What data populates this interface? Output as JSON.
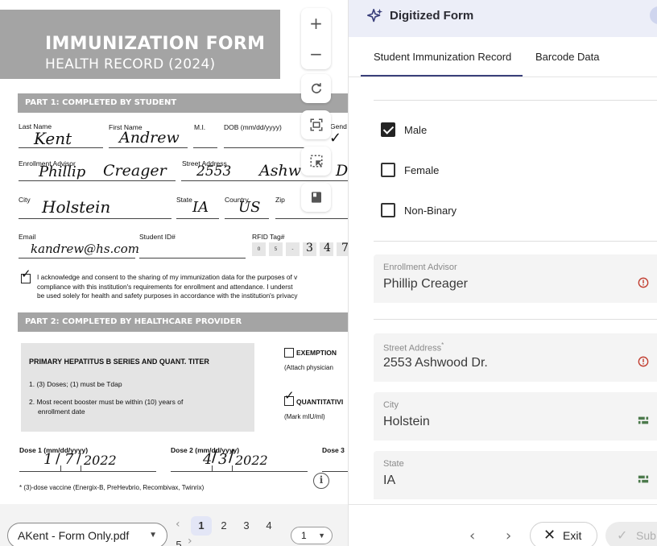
{
  "document": {
    "banner_title": "IMMUNIZATION FORM",
    "banner_subtitle": "HEALTH RECORD (2024)",
    "part1_title": "PART 1: COMPLETED BY STUDENT",
    "part2_title": "PART 2: COMPLETED BY HEALTHCARE PROVIDER",
    "labels": {
      "last_name": "Last Name",
      "first_name": "First Name",
      "mi": "M.I.",
      "dob": "DOB (mm/dd/yyyy)",
      "gender": "Gend",
      "advisor": "Enrollment Advisor",
      "street": "Street Address",
      "city": "City",
      "state": "State",
      "country": "Country",
      "zip": "Zip",
      "email": "Email",
      "student_id": "Student ID#",
      "rfid": "RFID Tag#"
    },
    "handwritten": {
      "last_name": "Kent",
      "first_name": "Andrew",
      "advisor_first": "Phillip",
      "advisor_last": "Creager",
      "street_number": "2553",
      "street_name": "Ashw",
      "street_extra": "D",
      "city": "Holstein",
      "state": "IA",
      "country": "US",
      "email": "kandrew@hs.com",
      "rfid_3": "3",
      "rfid_4": "4",
      "rfid_5": "7",
      "dose1_m": "1",
      "dose1_d": "7",
      "dose1_y": "2022",
      "dose2_m": "4",
      "dose2_d": "3",
      "dose2_y": "2022"
    },
    "rfid_cells": [
      "0",
      "5",
      "-"
    ],
    "ack_lines": [
      "I acknowledge and consent to the sharing of my immunization data for the purposes of v",
      "compliance with this institution's requirements for enrollment and attendance. I underst",
      "be used solely for health and safety purposes in accordance with the institution's privacy"
    ],
    "hepb": {
      "title": "PRIMARY HEPATITUS B SERIES AND QUANT. TITER",
      "line1": "1. (3) Doses; (1) must be Tdap",
      "line2a": "2. Most recent booster must be within (10) years of",
      "line2b": "enrollment date"
    },
    "exemption_label": "EXEMPTION",
    "exemption_note": "(Attach physician",
    "quantitative_label": "QUANTITATIVI",
    "quantitative_note": "(Mark mIU/ml)",
    "dose1_label": "Dose 1 (mm/dd/yyyy)",
    "dose2_label": "Dose 2 (mm/dd/yyyy)",
    "dose3_label": "Dose 3",
    "vaccine_note": "* (3)-dose vaccine (Energix-B, PreHevbrio, Recombivax, Twinrix)"
  },
  "toolbar": {
    "zoom_in": "+",
    "zoom_out": "−"
  },
  "pager": {
    "file_name": "AKent - Form Only.pdf",
    "pages": [
      "1",
      "2",
      "3",
      "4",
      "5"
    ],
    "active_page": "1",
    "page_select": "1"
  },
  "form": {
    "title": "Digitized Form",
    "tabs": [
      "Student Immunization Record",
      "Barcode Data"
    ],
    "gender_options": [
      {
        "label": "Male",
        "checked": true
      },
      {
        "label": "Female",
        "checked": false
      },
      {
        "label": "Non-Binary",
        "checked": false
      }
    ],
    "fields": {
      "advisor": {
        "label": "Enrollment Advisor",
        "value": "Phillip Creager",
        "status": "error"
      },
      "street": {
        "label": "Street Address",
        "required_mark": "*",
        "value": "2553 Ashwood Dr.",
        "status": "error"
      },
      "city": {
        "label": "City",
        "value": "Holstein",
        "status": "barcode"
      },
      "state": {
        "label": "State",
        "value": "IA",
        "status": "barcode"
      }
    },
    "exit_label": "Exit",
    "submit_label": "Sub"
  },
  "colors": {
    "header_bg": "#eceef8",
    "accent": "#3a3f7a",
    "error": "#c0392b",
    "barcode": "#4c7a4c",
    "banner": "#a4a4a4"
  }
}
